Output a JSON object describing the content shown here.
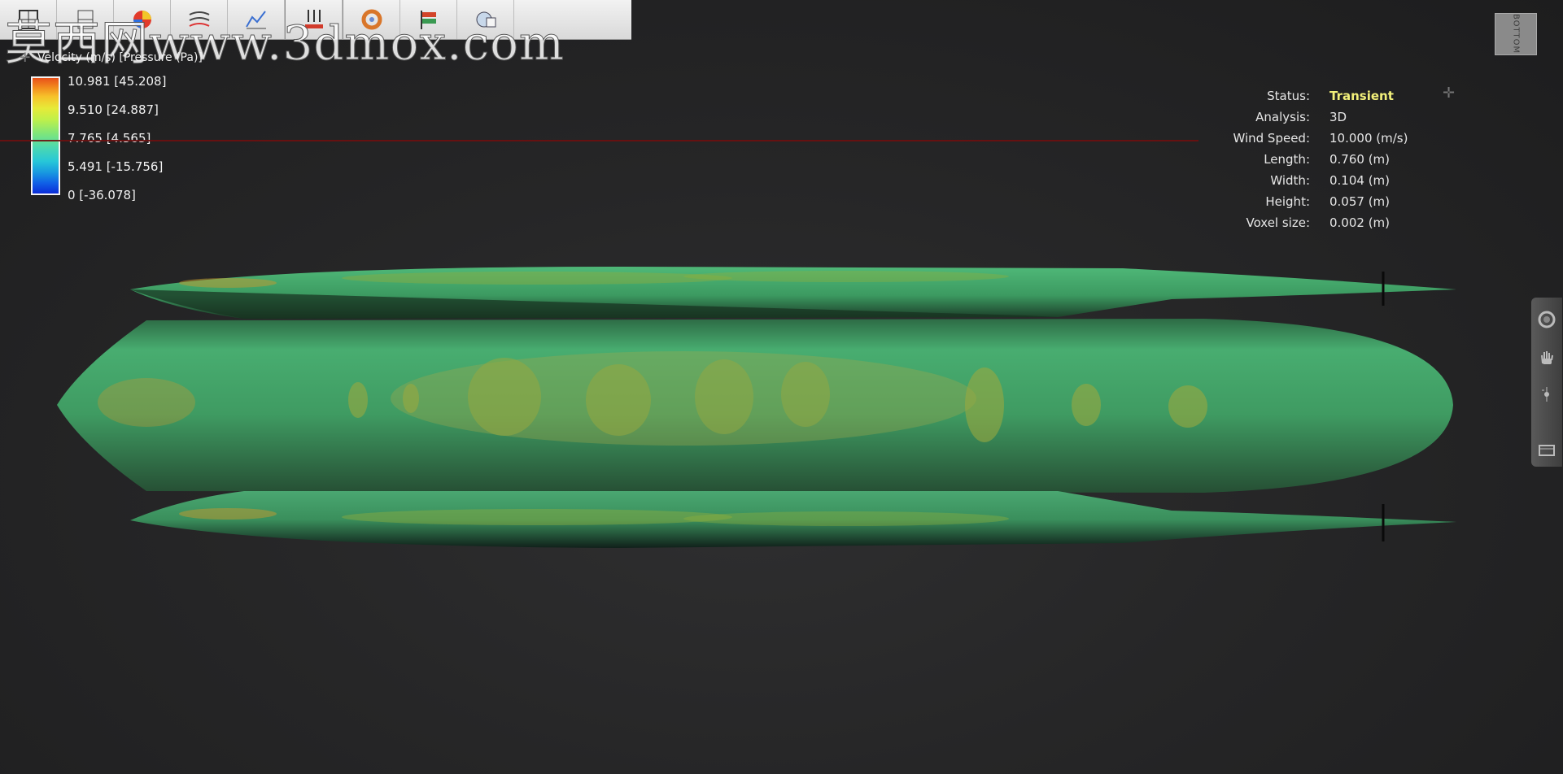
{
  "toolbar": {
    "buttons": [
      {
        "name": "grid-icon"
      },
      {
        "name": "plane-icon"
      },
      {
        "name": "color-sphere-icon"
      },
      {
        "name": "streamline-icon"
      },
      {
        "name": "chart-icon"
      },
      {
        "name": "force-arrows-icon"
      },
      {
        "name": "donut-icon"
      },
      {
        "name": "flag-icon"
      },
      {
        "name": "settings-icon"
      }
    ]
  },
  "watermark": "莫西网www.3dmox.com",
  "legend": {
    "title": "Velocity (m/s) [Pressure (Pa)]",
    "labels": [
      "10.981 [45.208]",
      "9.510 [24.887]",
      "7.765 [4.565]",
      "5.491 [-15.756]",
      "0 [-36.078]"
    ]
  },
  "info": {
    "rows": [
      {
        "key": "Status:",
        "value": "Transient"
      },
      {
        "key": "Analysis:",
        "value": "3D"
      },
      {
        "key": "Wind Speed:",
        "value": "10.000 (m/s)"
      },
      {
        "key": "Length:",
        "value": "0.760 (m)"
      },
      {
        "key": "Width:",
        "value": "0.104 (m)"
      },
      {
        "key": "Height:",
        "value": "0.057 (m)"
      },
      {
        "key": "Voxel size:",
        "value": "0.002 (m)"
      }
    ]
  },
  "viewcube": {
    "label": "BOTTOM"
  },
  "navbar": {
    "icons": [
      "orbit-icon",
      "pan-hand-icon",
      "zoom-slider-icon",
      "view-icon"
    ]
  },
  "colors": {
    "status": "#f2f07a",
    "hull_green": "#3f9a62",
    "background": "#262627"
  }
}
